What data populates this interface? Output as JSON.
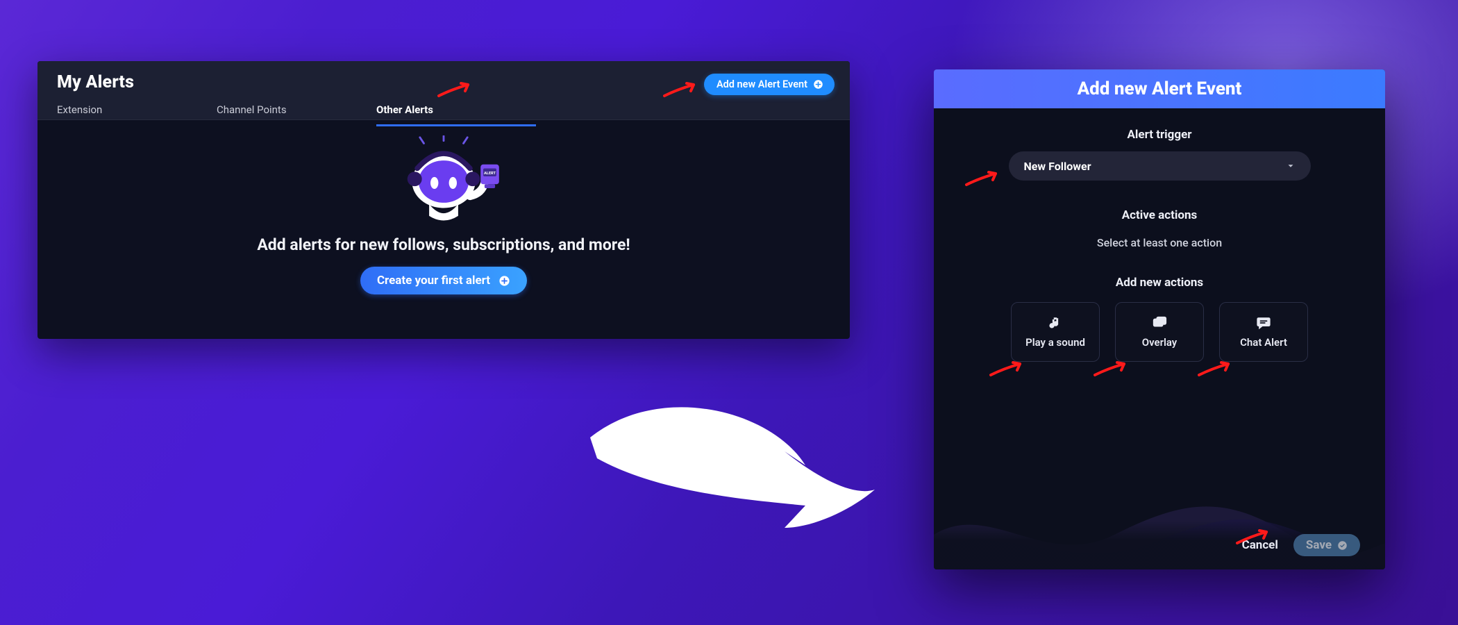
{
  "alerts_panel": {
    "title": "My Alerts",
    "tabs": [
      {
        "label": "Extension",
        "active": false
      },
      {
        "label": "Channel Points",
        "active": false
      },
      {
        "label": "Other Alerts",
        "active": true
      }
    ],
    "add_button_label": "Add new Alert Event",
    "empty_heading": "Add alerts for new follows, subscriptions, and more!",
    "cta_label": "Create your first alert"
  },
  "modal": {
    "title": "Add new Alert Event",
    "trigger_label": "Alert trigger",
    "trigger_value": "New Follower",
    "active_actions_label": "Active actions",
    "active_actions_sub": "Select at least one action",
    "add_actions_label": "Add new actions",
    "actions": [
      {
        "icon": "music-note-icon",
        "label": "Play a sound"
      },
      {
        "icon": "overlay-icon",
        "label": "Overlay"
      },
      {
        "icon": "chat-icon",
        "label": "Chat Alert"
      }
    ],
    "cancel_label": "Cancel",
    "save_label": "Save"
  },
  "colors": {
    "primary_blue": "#1f8cff",
    "gradient_blue_a": "#2f6df6",
    "gradient_blue_b": "#3aa2ff",
    "modal_header_a": "#5a6cff",
    "modal_header_b": "#3b7bff",
    "annotation_red": "#ff1a1a"
  }
}
